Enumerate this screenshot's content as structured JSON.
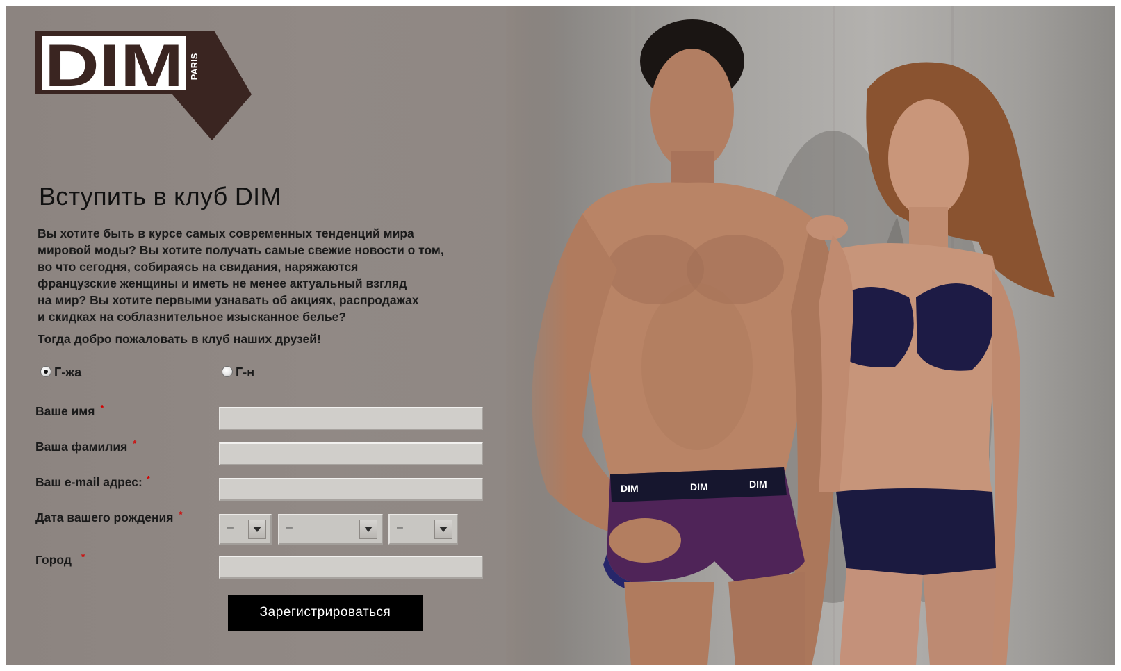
{
  "brand": {
    "logo_text": "DIM",
    "logo_sub": "PARIS",
    "colors": {
      "logo_dark": "#3a2521",
      "panel_bg": "#8f8782",
      "button_bg": "#000000",
      "required_star": "#d40000"
    }
  },
  "form": {
    "title": "Вступить в клуб DIM",
    "intro_lines": [
      "Вы хотите быть в курсе самых современных тенденций мира",
      "мировой моды? Вы хотите получать самые свежие новости о том,",
      "во что сегодня, собираясь на свидания, наряжаются",
      "французские женщины и иметь не менее актуальный взгляд",
      "на мир? Вы хотите первыми узнавать об акциях, распродажах",
      "и скидках на соблазнительное изысканное белье?"
    ],
    "welcome": "Тогда добро пожаловать в клуб наших друзей!",
    "salutation": {
      "options": [
        {
          "label": "Г-жа",
          "checked": true
        },
        {
          "label": "Г-н",
          "checked": false
        }
      ]
    },
    "fields": {
      "first_name": {
        "label": "Ваше имя",
        "required": "*",
        "value": ""
      },
      "last_name": {
        "label": "Ваша фамилия",
        "required": "*",
        "value": ""
      },
      "email": {
        "label": "Ваш e-mail адрес:",
        "required": "*",
        "value": ""
      },
      "birth_date": {
        "label": "Дата вашего рождения",
        "required": "*",
        "day": "–",
        "month": "–",
        "year": "–"
      },
      "city": {
        "label": "Город",
        "required": "*",
        "value": ""
      }
    },
    "submit_label": "Зарегистрироваться"
  },
  "hero": {
    "waistband_text": "DIM"
  }
}
